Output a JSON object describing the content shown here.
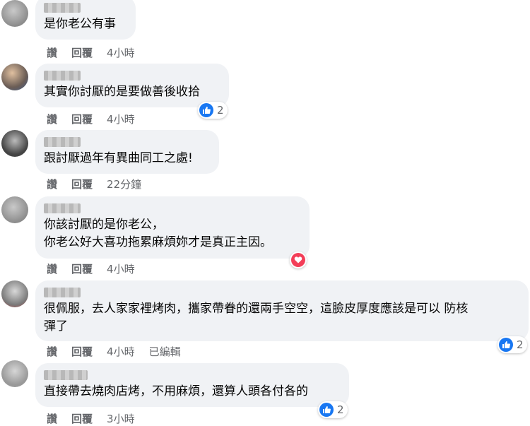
{
  "actions": {
    "like": "讚",
    "reply": "回覆",
    "edited": "已編輯"
  },
  "comments": [
    {
      "author": "■■■■",
      "lines": [
        "是你老公有事"
      ],
      "time": "4小時"
    },
    {
      "author": "■■■■",
      "lines": [
        "其實你討厭的是要做善後收拾"
      ],
      "time": "4小時",
      "reaction": "like",
      "reaction_count": "2"
    },
    {
      "author": "■■■■",
      "lines": [
        "跟討厭過年有異曲同工之處!"
      ],
      "time": "22分鐘"
    },
    {
      "author": "■■■■",
      "lines": [
        "你該討厭的是你老公，",
        "你老公好大喜功拖累麻煩妳才是真正主因。"
      ],
      "time": "4小時",
      "reaction": "love"
    },
    {
      "author": "■■■■",
      "lines": [
        "很佩服，去人家家裡烤肉，攜家帶眷的還兩手空空，這臉皮厚度應該是可以 防核",
        "彈了"
      ],
      "time": "4小時",
      "edited": true,
      "reaction": "like",
      "reaction_count": "2"
    },
    {
      "author": "■■■■",
      "lines": [
        "直接帶去燒肉店烤，不用麻煩，還算人頭各付各的"
      ],
      "time": "3小時",
      "reaction": "like",
      "reaction_count": "2"
    }
  ],
  "colors": {
    "bubble": "#f0f2f5",
    "like": "#1877f2",
    "love": "#f33e58",
    "meta": "#65676b"
  }
}
